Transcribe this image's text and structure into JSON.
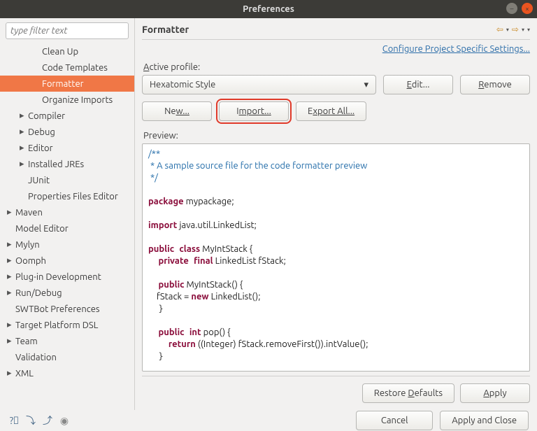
{
  "window": {
    "title": "Preferences"
  },
  "filter": {
    "placeholder": "type filter text"
  },
  "tree": [
    {
      "label": "Clean Up",
      "level": 2,
      "exp": ""
    },
    {
      "label": "Code Templates",
      "level": 2,
      "exp": ""
    },
    {
      "label": "Formatter",
      "level": 2,
      "exp": "",
      "selected": true
    },
    {
      "label": "Organize Imports",
      "level": 2,
      "exp": ""
    },
    {
      "label": "Compiler",
      "level": 1,
      "exp": "▸"
    },
    {
      "label": "Debug",
      "level": 1,
      "exp": "▸"
    },
    {
      "label": "Editor",
      "level": 1,
      "exp": "▸"
    },
    {
      "label": "Installed JREs",
      "level": 1,
      "exp": "▸"
    },
    {
      "label": "JUnit",
      "level": 1,
      "exp": ""
    },
    {
      "label": "Properties Files Editor",
      "level": 1,
      "exp": ""
    },
    {
      "label": "Maven",
      "level": 0,
      "exp": "▸"
    },
    {
      "label": "Model Editor",
      "level": 0,
      "exp": ""
    },
    {
      "label": "Mylyn",
      "level": 0,
      "exp": "▸"
    },
    {
      "label": "Oomph",
      "level": 0,
      "exp": "▸"
    },
    {
      "label": "Plug-in Development",
      "level": 0,
      "exp": "▸"
    },
    {
      "label": "Run/Debug",
      "level": 0,
      "exp": "▸"
    },
    {
      "label": "SWTBot Preferences",
      "level": 0,
      "exp": ""
    },
    {
      "label": "Target Platform DSL",
      "level": 0,
      "exp": "▸"
    },
    {
      "label": "Team",
      "level": 0,
      "exp": "▸"
    },
    {
      "label": "Validation",
      "level": 0,
      "exp": ""
    },
    {
      "label": "XML",
      "level": 0,
      "exp": "▸"
    }
  ],
  "header": {
    "title": "Formatter"
  },
  "link": {
    "configure": "Configure Project Specific Settings..."
  },
  "profile": {
    "label_pre": "A",
    "label_post": "ctive profile:",
    "value": "Hexatomic Style",
    "edit_pre": "E",
    "edit_post": "dit...",
    "remove_pre": "R",
    "remove_post": "emove",
    "new_pre": "Ne",
    "new_post": "w...",
    "import_pre": "I",
    "import_post": "mport...",
    "export_pre": "E",
    "export_post": "xport All..."
  },
  "preview": {
    "label_pre": "",
    "label_post": "Preview:"
  },
  "code": {
    "doc1": "/**",
    "doc2": " * A sample source file for the code formatter preview",
    "doc3": " */",
    "pkg_kw": "package",
    "pkg_name": " mypackage;",
    "imp_kw": "import",
    "imp_name": " java.util.LinkedList;",
    "pub": "public",
    "cls": "class",
    "clname": " MyIntStack {",
    "priv": "private",
    "fin": "final",
    "ftype": " LinkedList fStack;",
    "ctor": " MyIntStack() {",
    "new_kw": "new",
    "assign_pre": "    fStack = ",
    "assign_post": " LinkedList();",
    "intkw": "int",
    "popdecl": " pop() {",
    "ret_kw": "return",
    "ret_body": " ((Integer) fStack.removeFirst()).intValue();"
  },
  "buttons": {
    "restore_pre": "Restore ",
    "restore_u": "D",
    "restore_post": "efaults",
    "apply_pre": "",
    "apply_u": "A",
    "apply_post": "pply",
    "cancel": "Cancel",
    "applyclose": "Apply and Close"
  }
}
